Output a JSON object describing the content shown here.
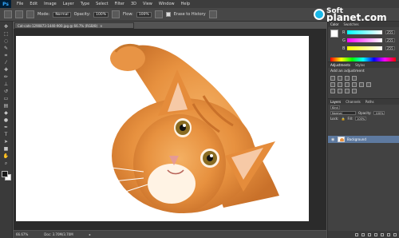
{
  "app": {
    "logo": "Ps"
  },
  "menu": [
    "File",
    "Edit",
    "Image",
    "Layer",
    "Type",
    "Select",
    "Filter",
    "3D",
    "View",
    "Window",
    "Help"
  ],
  "options": {
    "mode_label": "Mode:",
    "mode_value": "Normal",
    "opacity_label": "Opacity:",
    "opacity_value": "100%",
    "flow_label": "Flow:",
    "flow_value": "100%",
    "erase_label": "Erase to History"
  },
  "document": {
    "tab_title": "Cat-cats-1290873-1440-900.jpg @ 66.7% (RGB/8)",
    "zoom": "66.67%",
    "doc_info": "Doc: 3.70M/3.70M"
  },
  "panels": {
    "color_tabs": [
      "Color",
      "Swatches"
    ],
    "rgb": [
      {
        "label": "R",
        "value": "255"
      },
      {
        "label": "G",
        "value": "255"
      },
      {
        "label": "B",
        "value": "255"
      }
    ],
    "adj_tabs": [
      "Adjustments",
      "Styles"
    ],
    "adj_title": "Add an adjustment",
    "layers_tabs": [
      "Layers",
      "Channels",
      "Paths"
    ],
    "kind_label": "Kind",
    "blend_mode": "Normal",
    "opacity_label": "Opacity:",
    "opacity_value": "100%",
    "lock_label": "Lock:",
    "fill_label": "Fill:",
    "fill_value": "100%",
    "layer_name": "Background"
  },
  "watermark": {
    "line1": "Soft",
    "line2": "planet.com"
  },
  "colors": {
    "accent": "#5e7aa0",
    "cat": "#e7913f"
  },
  "tools": [
    "move-tool",
    "marquee-tool",
    "lasso-tool",
    "quick-select-tool",
    "crop-tool",
    "eyedropper-tool",
    "healing-tool",
    "brush-tool",
    "clone-stamp-tool",
    "history-brush-tool",
    "eraser-tool",
    "gradient-tool",
    "blur-tool",
    "dodge-tool",
    "pen-tool",
    "type-tool",
    "path-select-tool",
    "shape-tool",
    "hand-tool",
    "zoom-tool"
  ]
}
